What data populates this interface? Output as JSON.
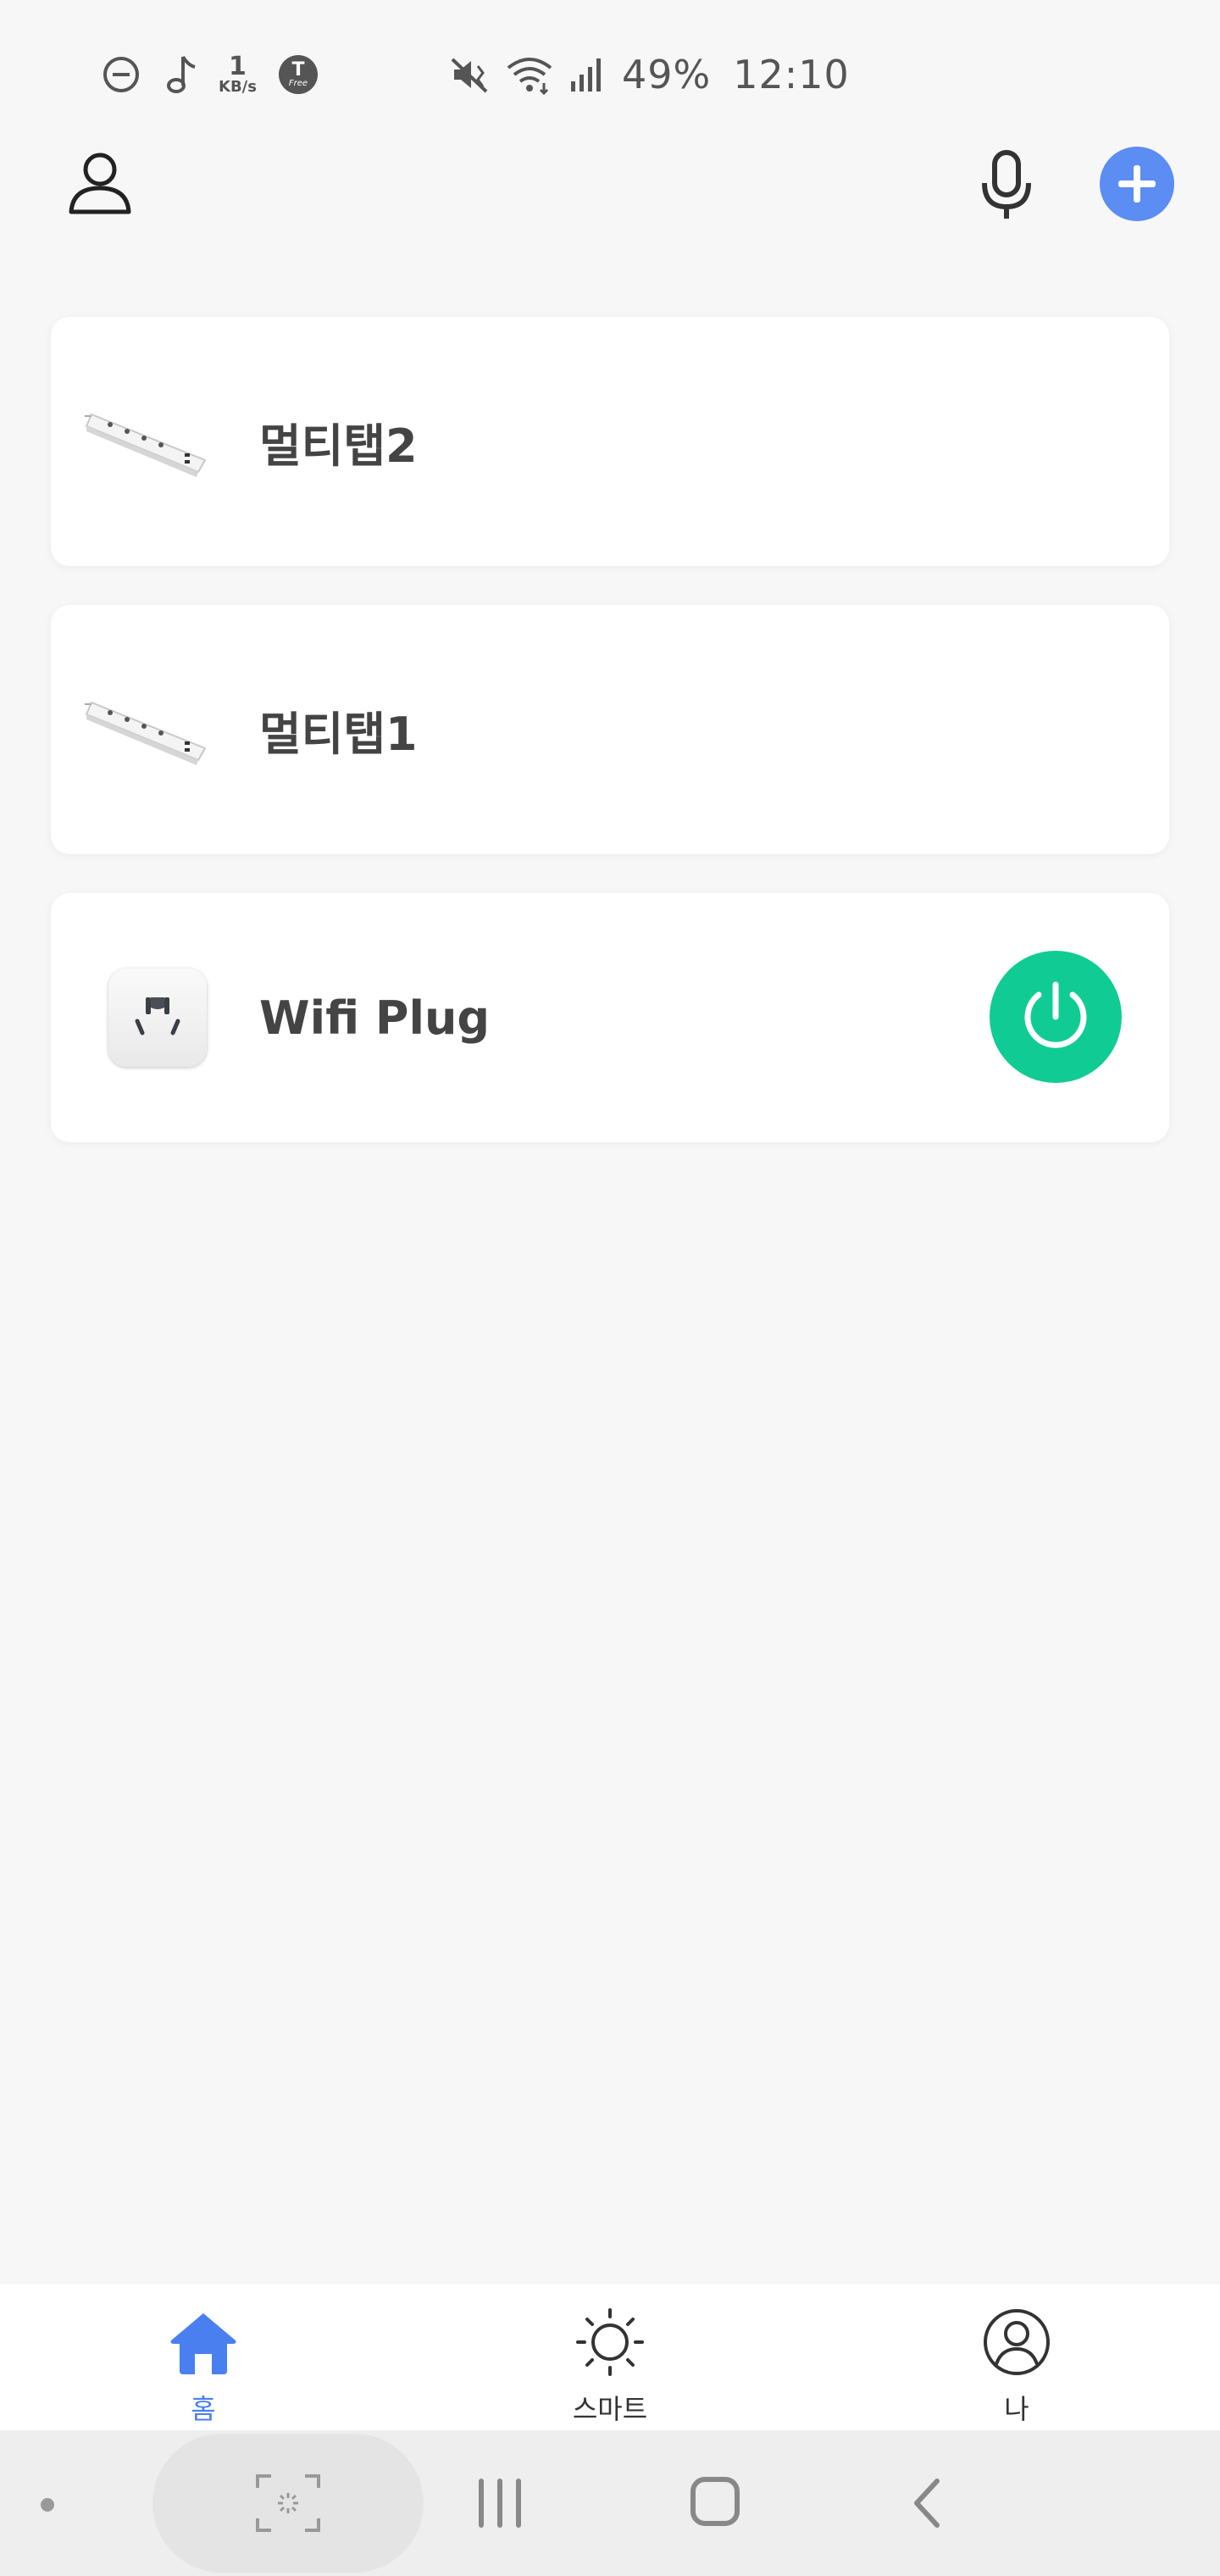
{
  "status_bar": {
    "net_speed_value": "1",
    "net_speed_unit": "KB/s",
    "tfree_main": "T",
    "tfree_sub": "Free",
    "battery": "49%",
    "time": "12:10"
  },
  "header": {
    "profile_icon": "person-icon",
    "voice_icon": "microphone-icon",
    "add_icon": "plus-icon"
  },
  "devices": [
    {
      "name": "멀티탭2",
      "icon": "power-strip-image"
    },
    {
      "name": "멀티탭1",
      "icon": "power-strip-image"
    },
    {
      "name": "Wifi Plug",
      "icon": "wall-plug-image",
      "power_button_color": "#10cc94"
    }
  ],
  "tab_bar": {
    "items": [
      {
        "label": "홈",
        "icon": "home-icon",
        "active": true
      },
      {
        "label": "스마트",
        "icon": "sun-icon",
        "active": false
      },
      {
        "label": "나",
        "icon": "user-circle-icon",
        "active": false
      }
    ]
  },
  "colors": {
    "accent": "#4a7ff0",
    "add_button": "#5b8df2",
    "power_on": "#10cc94",
    "background": "#f7f7f7"
  }
}
